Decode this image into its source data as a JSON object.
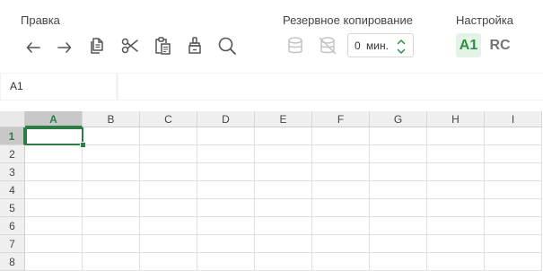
{
  "toolbar": {
    "groups": {
      "edit": "Правка",
      "backup": "Резервное копирование",
      "settings": "Настройка"
    },
    "edit_icons": [
      "undo-icon",
      "redo-icon",
      "copy-icon",
      "cut-icon",
      "paste-icon",
      "format-painter-icon"
    ],
    "extra_icons": [
      "search-icon"
    ],
    "backup_icons": [
      "database-icon",
      "database-off-icon"
    ],
    "backup_interval": {
      "value": "0",
      "unit": "мин."
    },
    "reference_style": {
      "a1": "A1",
      "rc": "RC",
      "active": "A1"
    }
  },
  "formula_bar": {
    "name_box": "A1",
    "formula": ""
  },
  "sheet": {
    "columns": [
      "A",
      "B",
      "C",
      "D",
      "E",
      "F",
      "G",
      "H",
      "I"
    ],
    "rows": [
      "1",
      "2",
      "3",
      "4",
      "5",
      "6",
      "7",
      "8"
    ],
    "active_cell": "A1",
    "accent_color": "#2f7d46"
  }
}
